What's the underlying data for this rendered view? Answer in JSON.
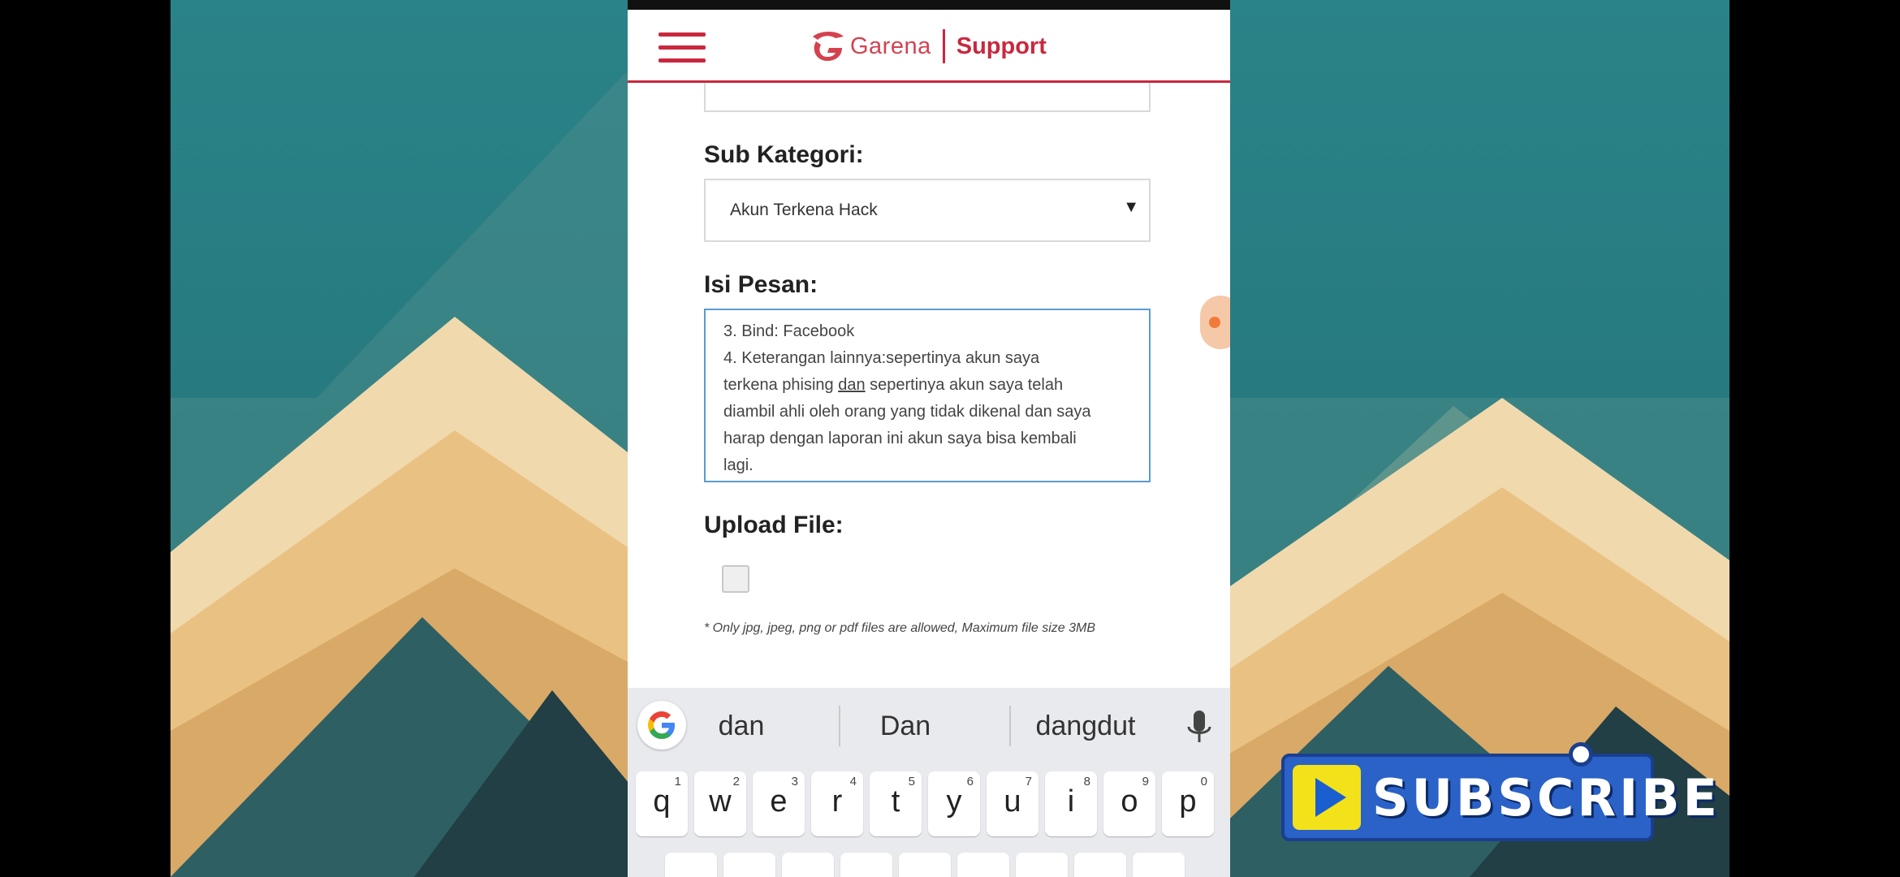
{
  "header": {
    "brand_name": "Garena",
    "brand_section": "Support"
  },
  "form": {
    "sub_category_label": "Sub Kategori:",
    "sub_category_value": "Akun Terkena Hack",
    "message_label": "Isi Pesan:",
    "message_lines": [
      "3. Bind: Facebook",
      "4. Keterangan lainnya:sepertinya akun saya",
      "terkena phising",
      "dan",
      "sepertinya akun saya telah",
      "diambil ahli oleh orang yang tidak dikenal dan saya",
      "harap dengan laporan ini akun saya bisa kembali",
      "lagi."
    ],
    "upload_label": "Upload File:",
    "upload_note": "* Only jpg, jpeg, png or pdf files are allowed, Maximum file size 3MB"
  },
  "keyboard": {
    "suggestions": [
      "dan",
      "Dan",
      "dangdut"
    ],
    "row1": [
      {
        "ch": "q",
        "num": "1"
      },
      {
        "ch": "w",
        "num": "2"
      },
      {
        "ch": "e",
        "num": "3"
      },
      {
        "ch": "r",
        "num": "4"
      },
      {
        "ch": "t",
        "num": "5"
      },
      {
        "ch": "y",
        "num": "6"
      },
      {
        "ch": "u",
        "num": "7"
      },
      {
        "ch": "i",
        "num": "8"
      },
      {
        "ch": "o",
        "num": "9"
      },
      {
        "ch": "p",
        "num": "0"
      }
    ]
  },
  "overlay": {
    "subscribe_label": "SUBSCRIBE"
  },
  "colors": {
    "brand_red": "#c9283e",
    "focus_blue": "#5b9bd5",
    "subscribe_blue": "#2a62c8",
    "subscribe_yellow": "#f3e11a"
  }
}
